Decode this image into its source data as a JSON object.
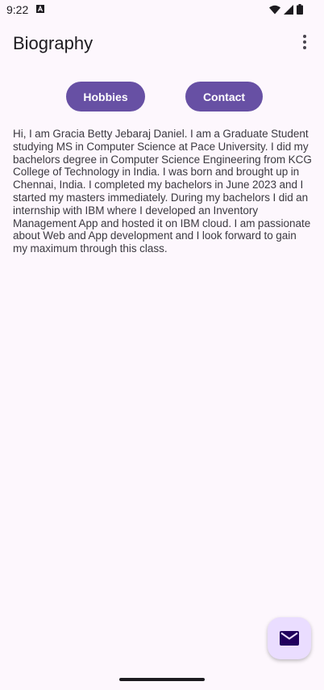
{
  "status_bar": {
    "time": "9:22",
    "icons": [
      "a-notification-icon",
      "wifi-icon",
      "signal-icon",
      "battery-icon"
    ]
  },
  "app_bar": {
    "title": "Biography",
    "menu_icon": "more-vert-icon"
  },
  "buttons": {
    "hobbies_label": "Hobbies",
    "contact_label": "Contact"
  },
  "bio": {
    "text": "Hi, I am Gracia Betty Jebaraj Daniel. I am a Graduate Student studying MS in Computer Science at Pace University. I did my bachelors degree in Computer Science Engineering from KCG College of Technology in India. I was born and brought up in Chennai, India. I completed my bachelors in June 2023 and I started my masters immediately. During my bachelors I did an internship with IBM where I developed an Inventory Management App and hosted it on IBM cloud. I am passionate about Web and App development and I look forward to gain my maximum through this class."
  },
  "fab": {
    "icon": "email-icon"
  },
  "colors": {
    "background": "#fdf7fd",
    "primary": "#6750a4",
    "fab_container": "#eaddff",
    "fab_icon": "#21005d"
  }
}
